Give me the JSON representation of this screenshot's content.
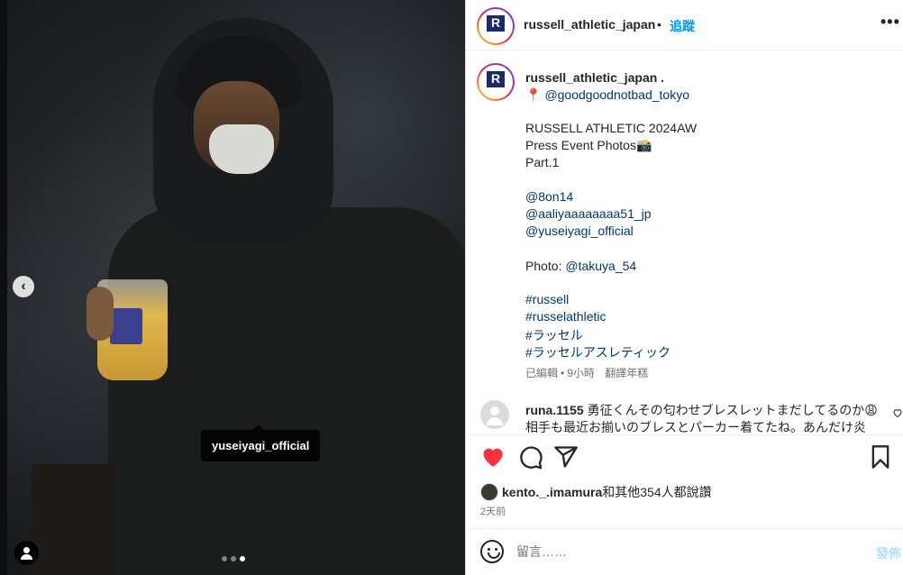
{
  "header": {
    "username": "russell_athletic_japan",
    "dot": "•",
    "follow": "追蹤",
    "more": "•••"
  },
  "post": {
    "tagged_user": "yuseiyagi_official"
  },
  "caption": {
    "username": "russell_athletic_japan .",
    "location_pin": "📍",
    "location": "@goodgoodnotbad_tokyo",
    "lines": [
      "RUSSELL ATHLETIC 2024AW",
      "Press Event Photos📸",
      "Part.1",
      "@8on14",
      "@aaliyaaaaaaaa51_jp",
      "@yuseiyagi_official",
      "Photo:",
      "@takuya_54",
      "#russell",
      "#russelathletic",
      "#ラッセル",
      "#ラッセルアスレティック"
    ],
    "edited": "已編輯",
    "dot": "•",
    "time": "9小時",
    "translate": "翻譯年糕"
  },
  "comment": {
    "username": "runa.1155",
    "line1": "勇征くんその匂わせブレスレットまだしてるのか😩",
    "line2": "相手も最近お揃いのブレスとパーカー着てたね。あんだけ炎"
  },
  "likes": {
    "user": "kento._.imamura",
    "rest": "和其他354人都說讚"
  },
  "date": "2天前",
  "add_comment": {
    "placeholder": "留言……",
    "post_label": "發佈"
  },
  "colors": {
    "accent": "#0095f6",
    "heart": "#ff3040",
    "link": "#00376b"
  },
  "icons": [
    "chevron-left-icon",
    "user-tag-icon",
    "more-icon",
    "heart-icon",
    "comment-icon",
    "share-icon",
    "bookmark-icon",
    "emoji-icon"
  ]
}
